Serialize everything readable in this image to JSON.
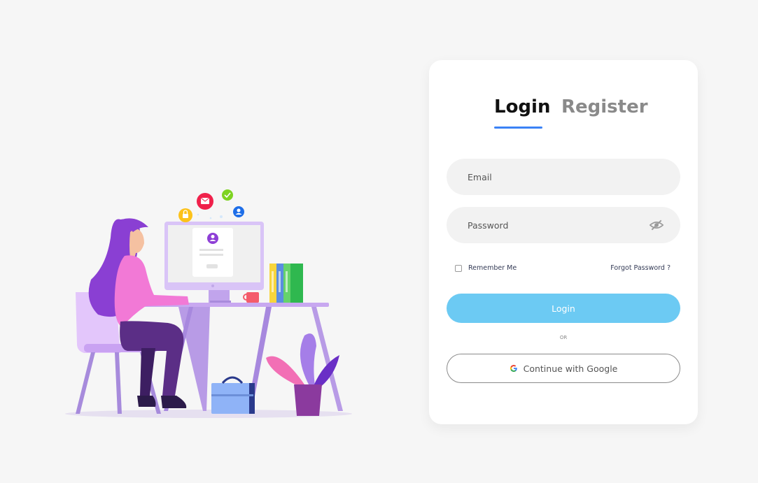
{
  "tabs": {
    "login": "Login",
    "register": "Register"
  },
  "form": {
    "email_placeholder": "Email",
    "password_placeholder": "Password",
    "remember_label": "Remember Me",
    "forgot_label": "Forgot Password ?",
    "login_label": "Login",
    "or_label": "OR",
    "google_label": "Continue with Google"
  },
  "icons": {
    "eye": "eye-slash-icon",
    "google": "google-logo-icon"
  },
  "colors": {
    "accent": "#3b82f6",
    "login_button": "#6ccaf3",
    "field_bg": "#f2f2f2",
    "page_bg": "#f6f6f6"
  }
}
